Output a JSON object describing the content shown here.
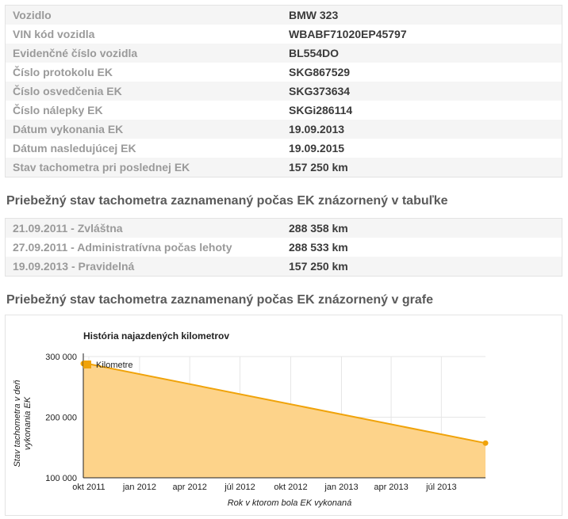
{
  "vehicle_info": [
    {
      "label": "Vozidlo",
      "value": "BMW 323"
    },
    {
      "label": "VIN kód vozidla",
      "value": "WBABF71020EP45797"
    },
    {
      "label": "Evidenčné číslo vozidla",
      "value": "BL554DO"
    },
    {
      "label": "Číslo protokolu EK",
      "value": "SKG867529"
    },
    {
      "label": "Číslo osvedčenia EK",
      "value": "SKG373634"
    },
    {
      "label": "Číslo nálepky EK",
      "value": "SKGi286114"
    },
    {
      "label": "Dátum vykonania EK",
      "value": "19.09.2013"
    },
    {
      "label": "Dátum nasledujúcej EK",
      "value": "19.09.2015"
    },
    {
      "label": "Stav tachometra pri poslednej EK",
      "value": "157 250 km"
    }
  ],
  "table_section": {
    "heading": "Priebežný stav tachometra zaznamenaný počas EK znázornený v tabuľke",
    "rows": [
      {
        "label": "21.09.2011 - Zvláštna",
        "value": "288 358 km"
      },
      {
        "label": "27.09.2011 - Administratívna počas lehoty",
        "value": "288 533 km"
      },
      {
        "label": "19.09.2013 - Pravidelná",
        "value": "157 250 km"
      }
    ]
  },
  "chart_section": {
    "heading": "Priebežný stav tachometra zaznamenaný počas EK znázornený v grafe"
  },
  "chart_data": {
    "type": "area",
    "title": "História najazdených kilometrov",
    "xlabel": "Rok v ktorom bola EK vykonaná",
    "ylabel_lines": [
      "Stav tachometra v deň",
      "vykonania EK"
    ],
    "legend": "Kilometre",
    "legend_position": "top-left",
    "x_ticks": [
      "okt 2011",
      "jan 2012",
      "apr 2012",
      "júl 2012",
      "okt 2012",
      "jan 2013",
      "apr 2013",
      "júl 2013"
    ],
    "y_ticks": [
      "100 000",
      "200 000",
      "300 000"
    ],
    "ylim": [
      100000,
      300000
    ],
    "grid": true,
    "series": [
      {
        "name": "Kilometre",
        "color": "#f0a30a",
        "fill": "#fdd38a",
        "points": [
          {
            "x": "2011-09-21",
            "y": 288358
          },
          {
            "x": "2011-09-27",
            "y": 288533
          },
          {
            "x": "2013-09-19",
            "y": 157250
          }
        ]
      }
    ]
  }
}
